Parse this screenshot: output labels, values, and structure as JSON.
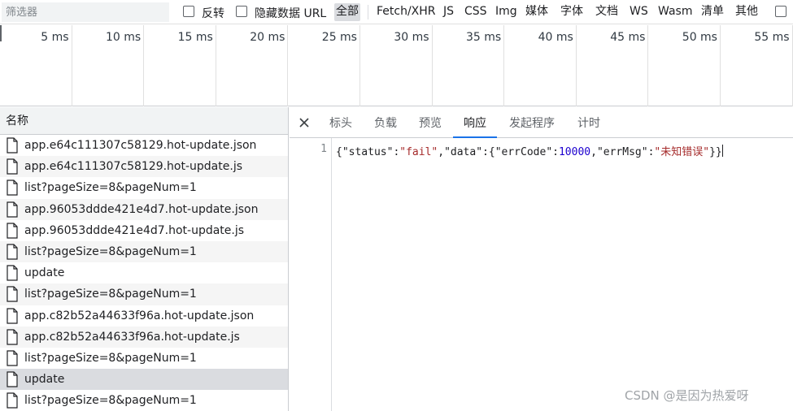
{
  "toolbar": {
    "filter_placeholder": "筛选器",
    "invert_label": "反转",
    "hide_data_urls_label": "隐藏数据 URL",
    "types": [
      {
        "label": "全部",
        "active": true
      },
      {
        "label": "Fetch/XHR",
        "active": false
      },
      {
        "label": "JS",
        "active": false
      },
      {
        "label": "CSS",
        "active": false
      },
      {
        "label": "Img",
        "active": false
      },
      {
        "label": "媒体",
        "active": false
      },
      {
        "label": "字体",
        "active": false
      },
      {
        "label": "文档",
        "active": false
      },
      {
        "label": "WS",
        "active": false
      },
      {
        "label": "Wasm",
        "active": false
      },
      {
        "label": "清单",
        "active": false
      },
      {
        "label": "其他",
        "active": false
      }
    ]
  },
  "overview": {
    "ticks": [
      "5 ms",
      "10 ms",
      "15 ms",
      "20 ms",
      "25 ms",
      "30 ms",
      "35 ms",
      "40 ms",
      "45 ms",
      "50 ms",
      "55 ms"
    ]
  },
  "request_list": {
    "header": "名称",
    "rows": [
      {
        "name": "app.e64c111307c58129.hot-update.json",
        "selected": false
      },
      {
        "name": "app.e64c111307c58129.hot-update.js",
        "selected": false
      },
      {
        "name": "list?pageSize=8&pageNum=1",
        "selected": false
      },
      {
        "name": "app.96053ddde421e4d7.hot-update.json",
        "selected": false
      },
      {
        "name": "app.96053ddde421e4d7.hot-update.js",
        "selected": false
      },
      {
        "name": "list?pageSize=8&pageNum=1",
        "selected": false
      },
      {
        "name": "update",
        "selected": false
      },
      {
        "name": "list?pageSize=8&pageNum=1",
        "selected": false
      },
      {
        "name": "app.c82b52a44633f96a.hot-update.json",
        "selected": false
      },
      {
        "name": "app.c82b52a44633f96a.hot-update.js",
        "selected": false
      },
      {
        "name": "list?pageSize=8&pageNum=1",
        "selected": false
      },
      {
        "name": "update",
        "selected": true
      },
      {
        "name": "list?pageSize=8&pageNum=1",
        "selected": false
      }
    ]
  },
  "detail": {
    "tabs": [
      {
        "label": "标头",
        "active": false
      },
      {
        "label": "负载",
        "active": false
      },
      {
        "label": "预览",
        "active": false
      },
      {
        "label": "响应",
        "active": true
      },
      {
        "label": "发起程序",
        "active": false
      },
      {
        "label": "计时",
        "active": false
      }
    ],
    "response": {
      "line_number": "1",
      "tokens": [
        {
          "t": "p",
          "v": "{"
        },
        {
          "t": "p",
          "v": "\"status\""
        },
        {
          "t": "p",
          "v": ":"
        },
        {
          "t": "s",
          "v": "\"fail\""
        },
        {
          "t": "p",
          "v": ","
        },
        {
          "t": "p",
          "v": "\"data\""
        },
        {
          "t": "p",
          "v": ":{"
        },
        {
          "t": "p",
          "v": "\"errCode\""
        },
        {
          "t": "p",
          "v": ":"
        },
        {
          "t": "n",
          "v": "10000"
        },
        {
          "t": "p",
          "v": ","
        },
        {
          "t": "p",
          "v": "\"errMsg\""
        },
        {
          "t": "p",
          "v": ":"
        },
        {
          "t": "s",
          "v": "\"未知错误\""
        },
        {
          "t": "p",
          "v": "}}"
        }
      ]
    }
  },
  "watermark": "CSDN @是因为热爱呀",
  "colors": {
    "accent": "#1a73e8",
    "string": "#a52a2a",
    "number": "#1c00cf",
    "selected_row": "#dadce0"
  }
}
